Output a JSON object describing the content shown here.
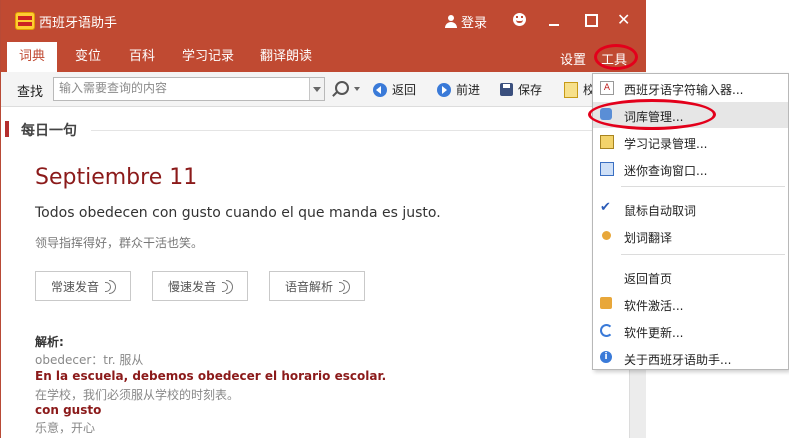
{
  "app": {
    "title": "西班牙语助手"
  },
  "titlebar": {
    "login_label": "登录",
    "close_glyph": "✕"
  },
  "tabs": [
    {
      "label": "词典",
      "active": true
    },
    {
      "label": "变位"
    },
    {
      "label": "百科"
    },
    {
      "label": "学习记录"
    },
    {
      "label": "翻译朗读"
    }
  ],
  "top_right": {
    "settings": "设置",
    "tools": "工具"
  },
  "toolbar": {
    "find_label": "查找",
    "search_placeholder": "输入需要查询的内容",
    "back": "返回",
    "forward": "前进",
    "save": "保存",
    "partial": "校"
  },
  "daily": {
    "section_title": "每日一句",
    "date": "Septiembre 11",
    "sentence_es": "Todos obedecen con gusto cuando el que manda es justo.",
    "sentence_cn": "领导指挥得好，群众干活也笑。",
    "buttons": [
      "常速发音",
      "慢速发音",
      "语音解析"
    ],
    "analysis_label": "解析:",
    "analysis": [
      {
        "text": "obedecer：tr. 服从",
        "style": "gray"
      },
      {
        "text": "En la escuela, debemos obedecer el horario escolar.",
        "style": "red"
      },
      {
        "text": "在学校，我们必须服从学校的时刻表。",
        "style": "gray"
      },
      {
        "text": "con gusto",
        "style": "red"
      },
      {
        "text": "乐意，开心",
        "style": "gray"
      }
    ]
  },
  "menu": {
    "items": [
      {
        "label": "西班牙语字符输入器...",
        "icon": "font-icon"
      },
      {
        "label": "词库管理...",
        "icon": "database-icon",
        "highlighted": true
      },
      {
        "label": "学习记录管理...",
        "icon": "clipboard-icon"
      },
      {
        "label": "迷你查询窗口...",
        "icon": "window-icon"
      },
      {
        "label": "鼠标自动取词",
        "icon": "check-icon",
        "checked": true
      },
      {
        "label": "划词翻译",
        "icon": "key-icon"
      },
      {
        "label": "返回首页",
        "icon": ""
      },
      {
        "label": "软件激活...",
        "icon": "lock-icon"
      },
      {
        "label": "软件更新...",
        "icon": "refresh-icon"
      },
      {
        "label": "关于西班牙语助手...",
        "icon": "info-icon"
      }
    ]
  },
  "colors": {
    "brand": "#c04a32",
    "accent_red": "#8b1a1a",
    "highlight_ring": "#e3001b"
  }
}
